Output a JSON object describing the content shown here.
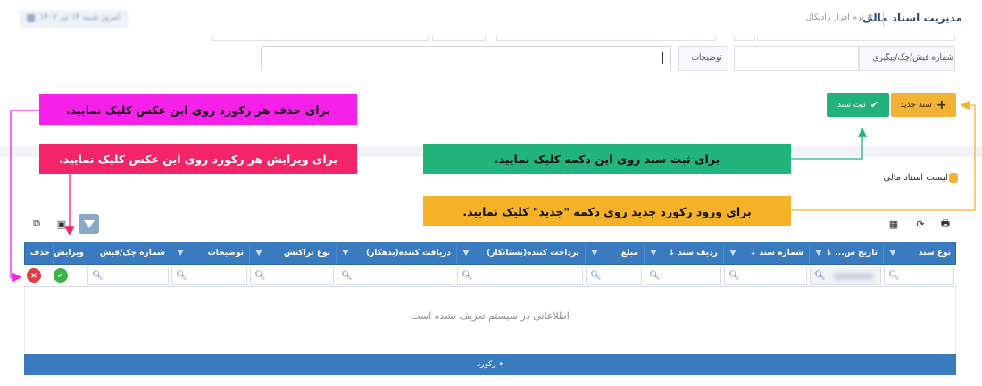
{
  "header": {
    "title": "مدیریت اسناد مالی",
    "subtitle": "# نرم افزار رادیکال",
    "date_chip": "امروز شنبه ۱۴ تیر ۱۴۰۲"
  },
  "form": {
    "receipt_label": "شماره فیش/چک/پیگیری",
    "description_label": "توضیحات",
    "description_value": ""
  },
  "toolbar": {
    "new_label": "سند جدید",
    "save_label": "ثبت سند",
    "new_icon": "plus-icon",
    "save_icon": "check-icon"
  },
  "annotations": {
    "delete_note": "برای حذف هر رکورد روی این عکس کلیک نمایید.",
    "edit_note": "برای ویرایش هر رکورد روی این عکس کلیک نمایید.",
    "save_note": "برای ثبت سند روی این دکمه کلیک نمایید.",
    "new_note": "برای ورود رکورد جدید روی دکمه \"جدید\" کلیک نمایید."
  },
  "list": {
    "title": "لیست اسناد مالی",
    "columns": [
      "نوع سند",
      "تاریخ س...",
      "شماره سند",
      "ردیف سند",
      "مبلغ",
      "پرداخت کننده(بستانکار)",
      "دریافت کننده(بدهکار)",
      "نوع تراکنش",
      "توضیحات",
      "شماره چک/فیش",
      "ویرایش",
      "حذف"
    ],
    "empty_message": "اطلاعاتی در سیستم تعریف نشده است",
    "footer_text": "• رکورد"
  },
  "colors": {
    "primary": "#3a7bbf",
    "accent_yellow": "#f2b233",
    "accent_green": "#22b27c",
    "note_magenta": "#f521e9",
    "note_pink": "#f42566",
    "note_green": "#21b47d",
    "note_yellow": "#f6b227"
  }
}
